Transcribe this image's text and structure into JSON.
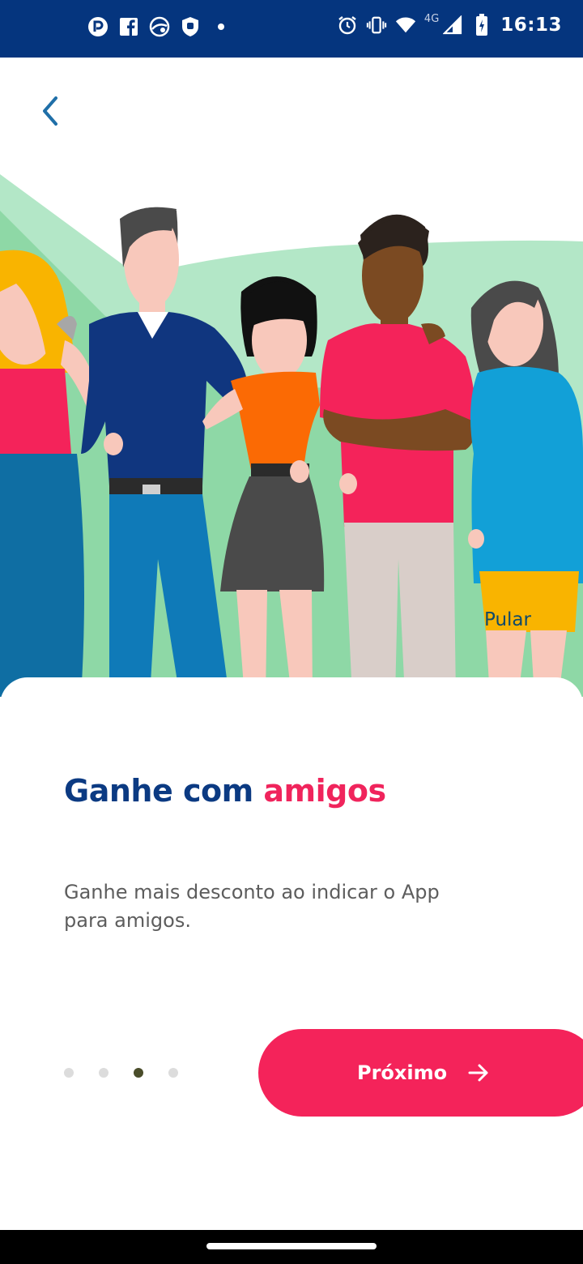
{
  "status_bar": {
    "time": "16:13",
    "network": "4G",
    "left_icons": [
      "app-p-icon",
      "facebook-icon",
      "browser-icon",
      "shield-icon",
      "dot-icon"
    ],
    "right_icons": [
      "alarm-icon",
      "vibrate-icon",
      "wifi-icon",
      "signal-icon",
      "battery-charging-icon"
    ],
    "background": "#05357e"
  },
  "header": {
    "back_icon": "chevron-left-icon"
  },
  "illustration": {
    "description_icon": "group-of-friends-illustration"
  },
  "skip": {
    "label": "Pular"
  },
  "content": {
    "title_part1": "Ganhe com ",
    "title_part2": "amigos",
    "description": "Ganhe mais desconto ao indicar o App para amigos."
  },
  "pager": {
    "total": 4,
    "current": 3
  },
  "next_button": {
    "label": "Próximo",
    "icon": "arrow-right-icon"
  },
  "colors": {
    "brand_blue": "#0b3a82",
    "brand_pink": "#f4235a",
    "hill_green": "#8fd9a8"
  }
}
